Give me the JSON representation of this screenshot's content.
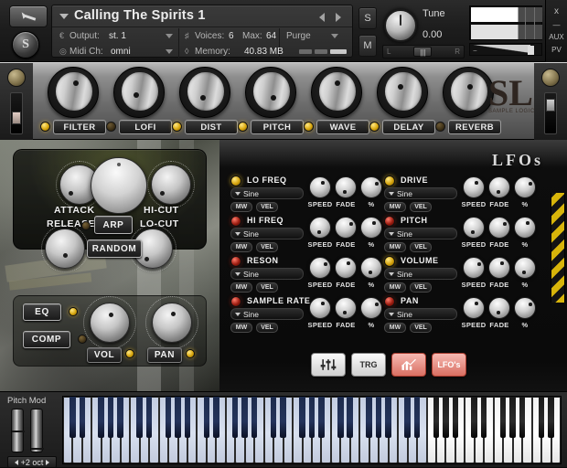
{
  "header": {
    "wrench_icon": "wrench-icon",
    "brand_icon": "sample-logic-badge",
    "instrument_name": "Calling The Spirits 1",
    "output_label": "Output:",
    "output_value": "st. 1",
    "midi_label": "Midi Ch:",
    "midi_value": "omni",
    "voices_label": "Voices:",
    "voices_value": "6",
    "max_label": "Max:",
    "max_value": "64",
    "memory_label": "Memory:",
    "memory_value": "40.83 MB",
    "purge_label": "Purge",
    "solo_button": "S",
    "mute_button": "M",
    "tune_label": "Tune",
    "tune_value": "0.00",
    "pan_left": "L",
    "pan_right": "R",
    "pan_center": "|||",
    "rail": {
      "close": "x",
      "minimize": "—",
      "aux": "AUX",
      "pv": "PV"
    }
  },
  "fx": {
    "items": [
      {
        "name": "FILTER",
        "led": "on"
      },
      {
        "name": "LOFI",
        "led": "off"
      },
      {
        "name": "DIST",
        "led": "on"
      },
      {
        "name": "PITCH",
        "led": "on"
      },
      {
        "name": "WAVE",
        "led": "on"
      },
      {
        "name": "DELAY",
        "led": "on"
      },
      {
        "name": "REVERB",
        "led": "off"
      }
    ],
    "logo_glyph": "SL",
    "logo_text": "SAMPLE LOGIC"
  },
  "envelope": {
    "attack_label": "ATTACK",
    "release_label": "RELEASE",
    "hicut_label": "HI-CUT",
    "locut_label": "LO-CUT",
    "arp_button": "ARP",
    "random_button": "RANDOM",
    "eq_button": "EQ",
    "comp_button": "COMP",
    "vol_label": "VOL",
    "pan_label": "PAN"
  },
  "lfo": {
    "title": "LFOs",
    "knob_labels": [
      "SPEED",
      "FADE",
      "%"
    ],
    "mw_label": "MW",
    "vel_label": "VEL",
    "column_left": [
      {
        "name": "LO FREQ",
        "led": "yellow",
        "wave": "Sine"
      },
      {
        "name": "HI FREQ",
        "led": "red",
        "wave": "Sine"
      },
      {
        "name": "RESON",
        "led": "red",
        "wave": "Sine"
      },
      {
        "name": "SAMPLE RATE",
        "led": "red",
        "wave": "Sine"
      }
    ],
    "column_right": [
      {
        "name": "DRIVE",
        "led": "yellow",
        "wave": "Sine"
      },
      {
        "name": "PITCH",
        "led": "red",
        "wave": "Sine"
      },
      {
        "name": "VOLUME",
        "led": "yellow",
        "wave": "Sine"
      },
      {
        "name": "PAN",
        "led": "red",
        "wave": "Sine"
      }
    ]
  },
  "tabs": [
    {
      "name": "mixer-faders-icon",
      "label": "",
      "active": false
    },
    {
      "name": "trigger-tab",
      "label": "TRG",
      "active": false
    },
    {
      "name": "envelope-graph-icon",
      "label": "",
      "active": true
    },
    {
      "name": "lfo-tab",
      "label": "LFO's",
      "active": true
    }
  ],
  "keyboard": {
    "pitch_mod_label": "Pitch Mod",
    "octave_label": "+2 oct",
    "mapped_white_keys": 38,
    "total_white_keys": 52
  },
  "colors": {
    "accent_yellow": "#e8c20a",
    "led_on": "#ffd23c",
    "led_off": "#43351a",
    "tab_active": "#d96f62",
    "mapped_key": "#c3cde2"
  }
}
